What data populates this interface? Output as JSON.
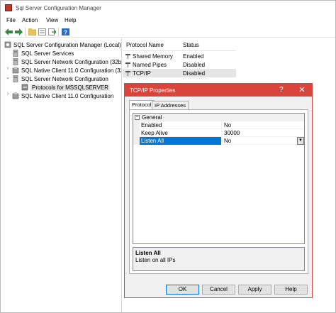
{
  "window": {
    "title": "Sql Server Configuration Manager"
  },
  "menu": {
    "items": [
      "File",
      "Action",
      "View",
      "Help"
    ]
  },
  "toolbar": {
    "buttons": [
      "back-icon",
      "forward-icon",
      "up-folder-icon",
      "properties-icon",
      "export-icon",
      "help-icon"
    ]
  },
  "tree": {
    "items": [
      {
        "label": "SQL Server Configuration Manager (Local)"
      },
      {
        "label": "SQL Server Services"
      },
      {
        "label": "SQL Server Network Configuration (32bit"
      },
      {
        "label": "SQL Native Client 11.0 Configuration (32b"
      },
      {
        "label": "SQL Server Network Configuration"
      },
      {
        "label": "Protocols for MSSQLSERVER"
      },
      {
        "label": "SQL Native Client 11.0 Configuration"
      }
    ]
  },
  "list": {
    "headers": {
      "name": "Protocol Name",
      "status": "Status"
    },
    "rows": [
      {
        "name": "Shared Memory",
        "status": "Enabled"
      },
      {
        "name": "Named Pipes",
        "status": "Disabled"
      },
      {
        "name": "TCP/IP",
        "status": "Disabled"
      }
    ]
  },
  "dialog": {
    "title": "TCP/IP Properties",
    "help": "?",
    "close": "✕",
    "tabs": [
      "Protocol",
      "IP Addresses"
    ],
    "category": "General",
    "properties": [
      {
        "key": "Enabled",
        "value": "No"
      },
      {
        "key": "Keep Alive",
        "value": "30000"
      },
      {
        "key": "Listen All",
        "value": "No"
      }
    ],
    "description": {
      "title": "Listen All",
      "text": "Listen on all IPs"
    },
    "buttons": {
      "ok": "OK",
      "cancel": "Cancel",
      "apply": "Apply",
      "help": "Help"
    }
  },
  "colors": {
    "accent": "#d9453a",
    "selection": "#0078d7"
  }
}
